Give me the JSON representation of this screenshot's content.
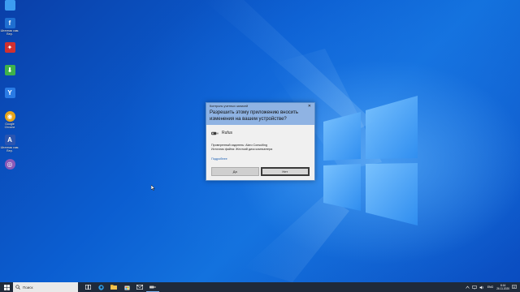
{
  "desktop": {
    "icons": [
      {
        "name": "this-pc",
        "label": "",
        "color": "#4fb0ff",
        "glyph": "▭"
      },
      {
        "name": "app-1",
        "label": "Штатная сам. Вер.",
        "color": "#1f6fd1",
        "glyph": "f"
      },
      {
        "name": "app-2",
        "label": "",
        "color": "#d03030",
        "glyph": "✦"
      },
      {
        "name": "app-3",
        "label": "",
        "color": "#3fb24a",
        "glyph": "⬇"
      },
      {
        "name": "app-4",
        "label": "",
        "color": "#2a7be4",
        "glyph": "Y"
      },
      {
        "name": "chrome",
        "label": "Google Chrome",
        "color": "#e8a41a",
        "glyph": "◉"
      },
      {
        "name": "app-6",
        "label": "Штатная сам. Вер.",
        "color": "#2a55b0",
        "glyph": "A"
      },
      {
        "name": "app-7",
        "label": "",
        "color": "#8a5ab8",
        "glyph": "◎"
      }
    ]
  },
  "uac": {
    "title": "Контроль учетных записей",
    "close": "✕",
    "question": "Разрешить этому приложению вносить изменения на вашем устройстве?",
    "app_name": "Rufus",
    "publisher": "Проверенный издатель: Akeo Consulting",
    "origin": "Источник файла: Жесткий диск компьютера",
    "more_link": "Подробнее",
    "yes_label": "Да",
    "no_label": "Нет"
  },
  "taskbar": {
    "search_placeholder": "Поиск",
    "apps": [
      "task-view",
      "edge",
      "explorer",
      "store",
      "mail",
      "rufus"
    ],
    "language": "ENG",
    "time": "8:16",
    "date": "26.11.2020"
  }
}
